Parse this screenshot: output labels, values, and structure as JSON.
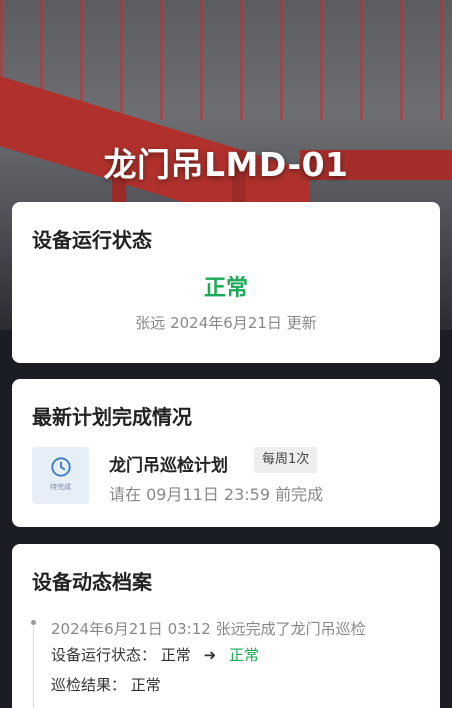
{
  "hero": {
    "title": "龙门吊LMD-01"
  },
  "status_card": {
    "title": "设备运行状态",
    "status": "正常",
    "updated_by": "张远",
    "updated_date": "2024年6月21日",
    "updated_suffix": "更新",
    "status_color": "#1aaa55"
  },
  "plan_card": {
    "title": "最新计划完成情况",
    "icon": "clock-icon",
    "icon_label": "待完成",
    "plan_name": "龙门吊巡检计划",
    "frequency": "每周1次",
    "due_prefix": "请在",
    "due_time": "09月11日 23:59",
    "due_suffix": "前完成"
  },
  "archive_card": {
    "title": "设备动态档案",
    "entries": [
      {
        "time": "2024年6月21日 03:12",
        "user": "张远",
        "action": "完成了龙门吊巡检",
        "status_label": "设备运行状态：",
        "status_from": "正常",
        "status_to": "正常",
        "result_label": "巡检结果：",
        "result_value": "正常"
      }
    ]
  }
}
